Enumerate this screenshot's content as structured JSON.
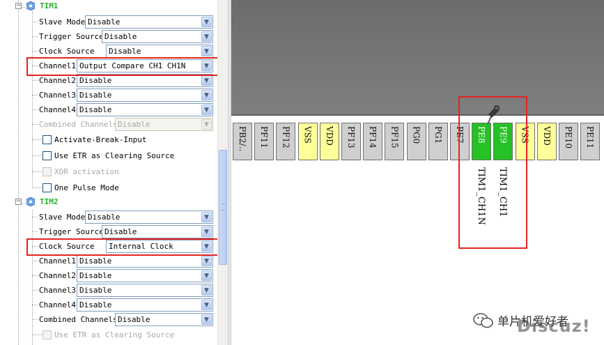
{
  "tim1": {
    "title": "TIM1",
    "slave_mode": {
      "label": "Slave Mode",
      "value": "Disable"
    },
    "trigger_source": {
      "label": "Trigger Source",
      "value": "Disable"
    },
    "clock_source": {
      "label": "Clock Source",
      "value": "Disable"
    },
    "channel1": {
      "label": "Channel1",
      "value": "Output Compare CH1 CH1N"
    },
    "channel2": {
      "label": "Channel2",
      "value": "Disable"
    },
    "channel3": {
      "label": "Channel3",
      "value": "Disable"
    },
    "channel4": {
      "label": "Channel4",
      "value": "Disable"
    },
    "combined_channels": {
      "label": "Combined Channels",
      "value": "Disable"
    },
    "activate_break_input": "Activate-Break-Input",
    "use_etr": "Use ETR as Clearing Source",
    "xor_activation": "XOR activation",
    "one_pulse_mode": "One Pulse Mode"
  },
  "tim2": {
    "title": "TIM2",
    "slave_mode": {
      "label": "Slave Mode",
      "value": "Disable"
    },
    "trigger_source": {
      "label": "Trigger Source",
      "value": "Disable"
    },
    "clock_source": {
      "label": "Clock Source",
      "value": "Internal Clock"
    },
    "channel1": {
      "label": "Channel1",
      "value": "Disable"
    },
    "channel2": {
      "label": "Channel2",
      "value": "Disable"
    },
    "channel3": {
      "label": "Channel3",
      "value": "Disable"
    },
    "channel4": {
      "label": "Channel4",
      "value": "Disable"
    },
    "combined_channels": {
      "label": "Combined Channels",
      "value": "Disable"
    },
    "use_etr": "Use ETR as Clearing Source"
  },
  "pins": [
    {
      "name": "PB2/..",
      "color": "gray"
    },
    {
      "name": "PF11",
      "color": "gray"
    },
    {
      "name": "PF12",
      "color": "gray"
    },
    {
      "name": "VSS",
      "color": "yellow"
    },
    {
      "name": "VDD",
      "color": "yellow"
    },
    {
      "name": "PF13",
      "color": "gray"
    },
    {
      "name": "PF14",
      "color": "gray"
    },
    {
      "name": "PF15",
      "color": "gray"
    },
    {
      "name": "PG0",
      "color": "gray"
    },
    {
      "name": "PG1",
      "color": "gray"
    },
    {
      "name": "PE7",
      "color": "gray"
    },
    {
      "name": "PE8",
      "color": "green"
    },
    {
      "name": "PE9",
      "color": "green"
    },
    {
      "name": "VSS",
      "color": "yellow"
    },
    {
      "name": "VDD",
      "color": "yellow"
    },
    {
      "name": "PE10",
      "color": "gray"
    },
    {
      "name": "PE11",
      "color": "gray"
    }
  ],
  "signals": {
    "pe8": "TIM1_CH1N",
    "pe9": "TIM1_CH1"
  },
  "watermark": {
    "text": "单片机爱好者",
    "site": "Discuz!"
  },
  "colors": {
    "group_title": "#2bb32b",
    "highlight_box": "#e52222",
    "pin_assigned": "#25c125",
    "pin_power": "#ffff99",
    "pin_free": "#cfcfcf"
  }
}
